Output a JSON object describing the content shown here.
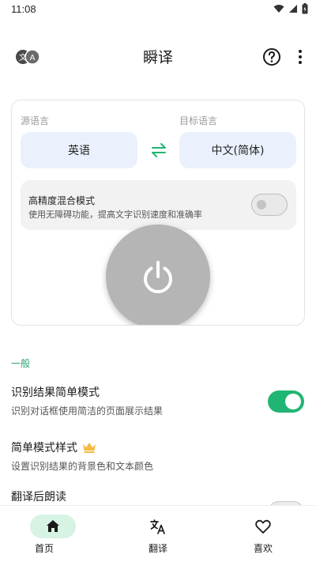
{
  "status_bar": {
    "time": "11:08"
  },
  "app_bar": {
    "title": "瞬译",
    "logo_icon": "translate-badge-icon",
    "help_icon": "help-circle-icon",
    "more_icon": "more-vert-icon"
  },
  "translator": {
    "source_label": "源语言",
    "target_label": "目标语言",
    "source_language": "英语",
    "target_language": "中文(简体)",
    "swap_icon": "swap-arrows-icon",
    "mode": {
      "title": "高精度混合模式",
      "description": "使用无障碍功能，提高文字识别速度和准确率",
      "enabled": false
    },
    "power_icon": "power-icon"
  },
  "general": {
    "header": "一般",
    "settings": [
      {
        "title": "识别结果简单模式",
        "description": "识别对话框使用简洁的页面展示结果",
        "enabled": true
      },
      {
        "title": "简单模式样式",
        "description": "设置识别结果的背景色和文本颜色",
        "badge_icon": "crown-icon"
      },
      {
        "title": "翻译后朗读",
        "description": ""
      }
    ]
  },
  "bottom_nav": {
    "items": [
      {
        "label": "首页",
        "icon": "home-icon",
        "active": true
      },
      {
        "label": "翻译",
        "icon": "translate-icon",
        "active": false
      },
      {
        "label": "喜欢",
        "icon": "heart-icon",
        "active": false
      }
    ]
  },
  "colors": {
    "accent": "#21b573",
    "accent_light": "#d6f3e4",
    "lang_button_bg": "#eaf1fc",
    "power_button": "#b5b5b5"
  }
}
